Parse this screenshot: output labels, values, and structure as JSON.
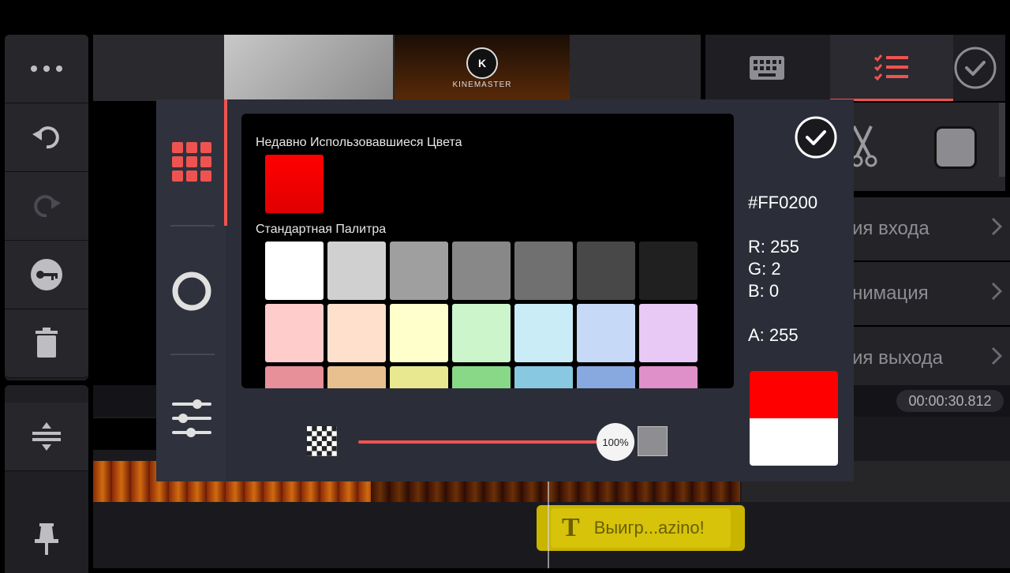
{
  "left_toolbar": {
    "items": [
      {
        "name": "more-button",
        "icon": "more-dots-icon"
      },
      {
        "name": "undo-button",
        "icon": "undo-icon"
      },
      {
        "name": "redo-button",
        "icon": "redo-icon"
      },
      {
        "name": "key-button",
        "icon": "key-icon"
      },
      {
        "name": "delete-button",
        "icon": "trash-icon"
      },
      {
        "name": "expand-timeline-button",
        "icon": "expand-vertical-icon"
      },
      {
        "name": "pin-button",
        "icon": "pin-icon"
      }
    ]
  },
  "preview": {
    "logo_text": "KINEMASTER"
  },
  "top_right": {
    "tabs": [
      {
        "name": "keyboard-tab",
        "icon": "keyboard-icon"
      },
      {
        "name": "options-tab",
        "icon": "checklist-icon",
        "active": true
      }
    ],
    "confirm_icon": "check-circle-icon"
  },
  "right_panel": {
    "items": [
      {
        "label": "ия входа"
      },
      {
        "label": "нимация"
      },
      {
        "label": "ия выхода"
      }
    ],
    "tools": [
      {
        "icon": "scissors-icon"
      },
      {
        "icon": "color-square-icon"
      }
    ]
  },
  "timeline": {
    "time": "00:00:30.812",
    "text_clip_label": "Выигр...azino!",
    "text_clip_icon": "text-T-icon"
  },
  "color_dialog": {
    "side_tabs": [
      {
        "name": "palette-tab",
        "icon": "grid-icon",
        "active": true
      },
      {
        "name": "wheel-tab",
        "icon": "ring-icon"
      },
      {
        "name": "sliders-tab",
        "icon": "sliders-icon"
      }
    ],
    "recent_label": "Недавно Использовавшиеся Цвета",
    "recent_colors": [
      "#ff0200"
    ],
    "standard_label": "Стандартная Палитра",
    "palette_rows": [
      [
        "#ffffff",
        "#d0d0d0",
        "#9f9f9f",
        "#888888",
        "#707070",
        "#484848",
        "#202020"
      ],
      [
        "#ffcccc",
        "#ffe0cc",
        "#ffffcc",
        "#ccf5cc",
        "#c9ecf7",
        "#c6daf7",
        "#e8c8f5"
      ],
      [
        "#e8909a",
        "#e8c090",
        "#e8e890",
        "#88d888",
        "#88c8e0",
        "#88a8e0",
        "#e090c8"
      ]
    ],
    "hex": "#FF0200",
    "r": "R: 255",
    "g": "G: 2",
    "b": "B: 0",
    "a": "A: 255",
    "opacity_label": "100%",
    "opacity_value": 1.0,
    "preview_new": "#ff0000",
    "preview_old": "#ffffff",
    "confirm_icon": "check-circle-icon"
  }
}
